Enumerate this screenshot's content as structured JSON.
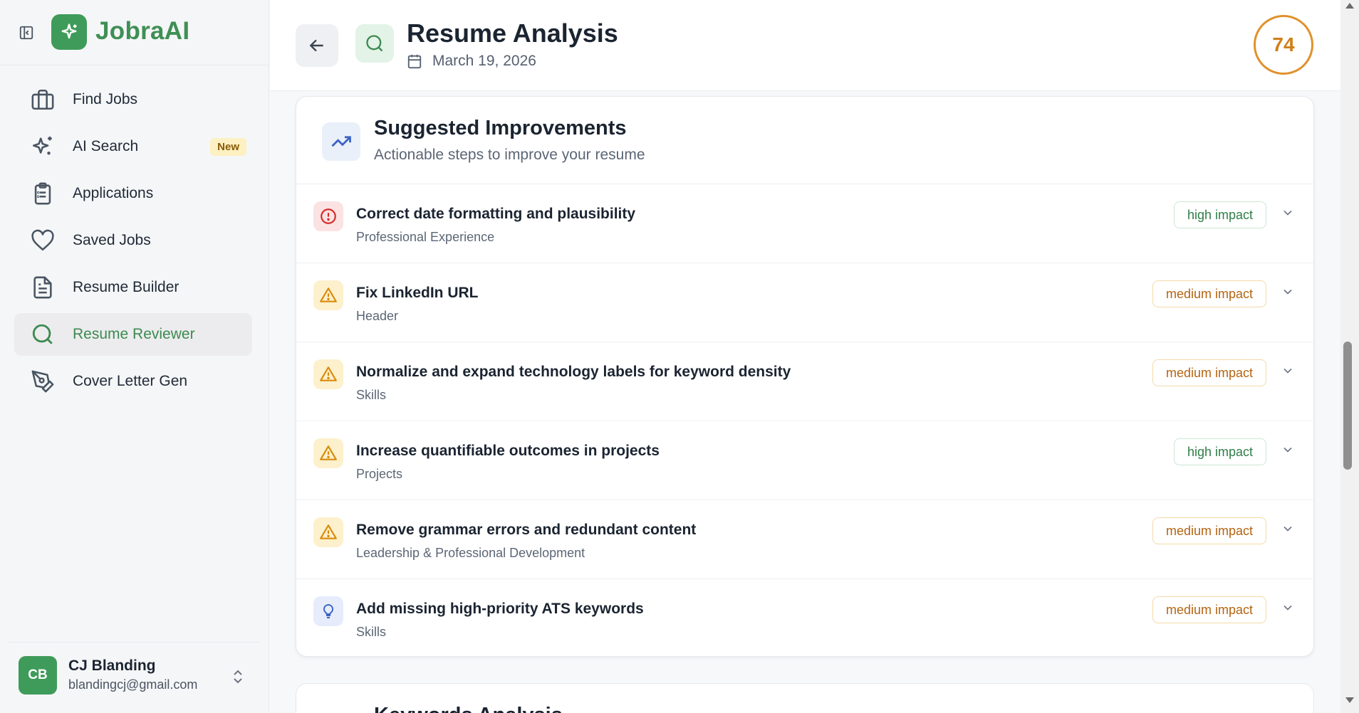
{
  "app": {
    "name": "JobraAI"
  },
  "sidebar": {
    "items": [
      {
        "label": "Find Jobs",
        "icon": "briefcase-icon"
      },
      {
        "label": "AI Search",
        "icon": "sparkles-icon",
        "badge": "New"
      },
      {
        "label": "Applications",
        "icon": "clipboard-icon"
      },
      {
        "label": "Saved Jobs",
        "icon": "heart-icon"
      },
      {
        "label": "Resume Builder",
        "icon": "document-icon"
      },
      {
        "label": "Resume Reviewer",
        "icon": "search-icon",
        "active": true
      },
      {
        "label": "Cover Letter Gen",
        "icon": "pen-tool-icon"
      }
    ],
    "user": {
      "initials": "CB",
      "name": "CJ Blanding",
      "email": "blandingcj@gmail.com"
    }
  },
  "header": {
    "title": "Resume Analysis",
    "date": "March 19, 2026",
    "score": "74"
  },
  "improvements": {
    "title": "Suggested Improvements",
    "subtitle": "Actionable steps to improve your resume",
    "items": [
      {
        "title": "Correct date formatting and plausibility",
        "section": "Professional Experience",
        "impact": "high impact",
        "icon": "alert-circle-icon"
      },
      {
        "title": "Fix LinkedIn URL",
        "section": "Header",
        "impact": "medium impact",
        "icon": "warning-triangle-icon"
      },
      {
        "title": "Normalize and expand technology labels for keyword density",
        "section": "Skills",
        "impact": "medium impact",
        "icon": "warning-triangle-icon"
      },
      {
        "title": "Increase quantifiable outcomes in projects",
        "section": "Projects",
        "impact": "high impact",
        "icon": "warning-triangle-icon"
      },
      {
        "title": "Remove grammar errors and redundant content",
        "section": "Leadership & Professional Development",
        "impact": "medium impact",
        "icon": "warning-triangle-icon"
      },
      {
        "title": "Add missing high-priority ATS keywords",
        "section": "Skills",
        "impact": "medium impact",
        "icon": "lightbulb-icon"
      }
    ]
  },
  "next_card": {
    "title": "Keywords Analysis"
  },
  "colors": {
    "brand": "#3f9b5a",
    "score_ring": "#e0912b",
    "high": "#2f7d47",
    "medium": "#b46411"
  }
}
